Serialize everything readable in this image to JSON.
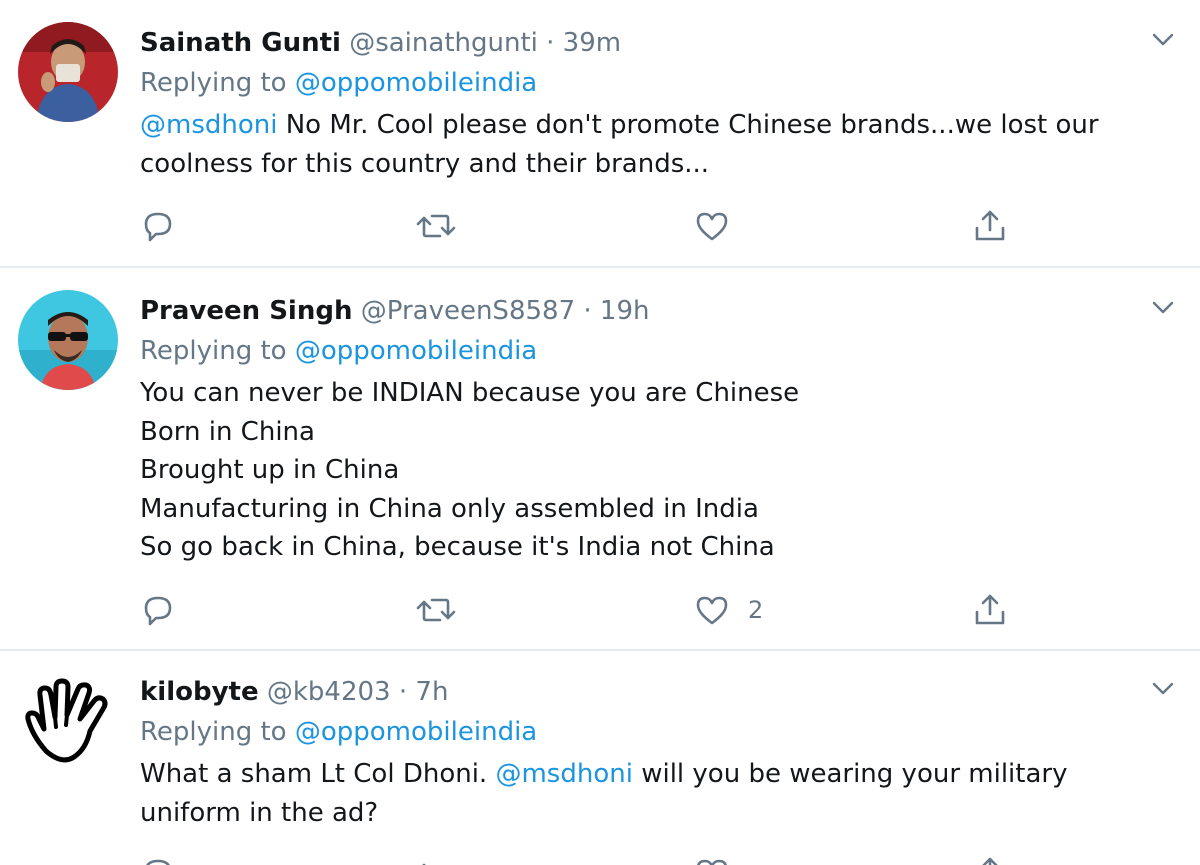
{
  "tweets": [
    {
      "name": "Sainath Gunti",
      "handle": "@sainathgunti",
      "separator": "·",
      "time": "39m",
      "replying_prefix": "Replying to",
      "replying_to": "@oppomobileindia",
      "text_lines": [
        {
          "mention": "@msdhoni",
          "rest": " No Mr. Cool please don't promote Chinese brands...we lost our"
        },
        {
          "mention": "",
          "rest": "coolness for this country and their brands..."
        }
      ],
      "like_count": "",
      "avatar": "photo-man-red-background"
    },
    {
      "name": "Praveen Singh",
      "handle": "@PraveenS8587",
      "separator": "·",
      "time": "19h",
      "replying_prefix": "Replying to",
      "replying_to": "@oppomobileindia",
      "text_lines": [
        {
          "mention": "",
          "rest": "You can never be INDIAN because you are Chinese"
        },
        {
          "mention": "",
          "rest": "Born in China"
        },
        {
          "mention": "",
          "rest": "Brought up in China"
        },
        {
          "mention": "",
          "rest": "Manufacturing in China only assembled in India"
        },
        {
          "mention": "",
          "rest": "So go back in China, because it's India not China"
        }
      ],
      "like_count": "2",
      "avatar": "photo-man-sunglasses"
    },
    {
      "name": "kilobyte",
      "handle": "@kb4203",
      "separator": "·",
      "time": "7h",
      "replying_prefix": "Replying to",
      "replying_to": "@oppomobileindia",
      "text_lines": [
        {
          "mention": "",
          "rest": "What a sham Lt Col Dhoni. ",
          "mention2": "@msdhoni",
          "rest2": " will you be wearing your military"
        },
        {
          "mention": "",
          "rest": "uniform in the ad?"
        }
      ],
      "like_count": "",
      "avatar": "vulcan-salute-hand-icon"
    }
  ],
  "icons": {
    "reply": "reply-icon",
    "retweet": "retweet-icon",
    "like": "heart-icon",
    "share": "share-icon",
    "more": "chevron-down-icon"
  },
  "colors": {
    "link": "#1b95e0",
    "secondary": "#657786",
    "text": "#14171a",
    "divider": "#e6ecf0"
  }
}
